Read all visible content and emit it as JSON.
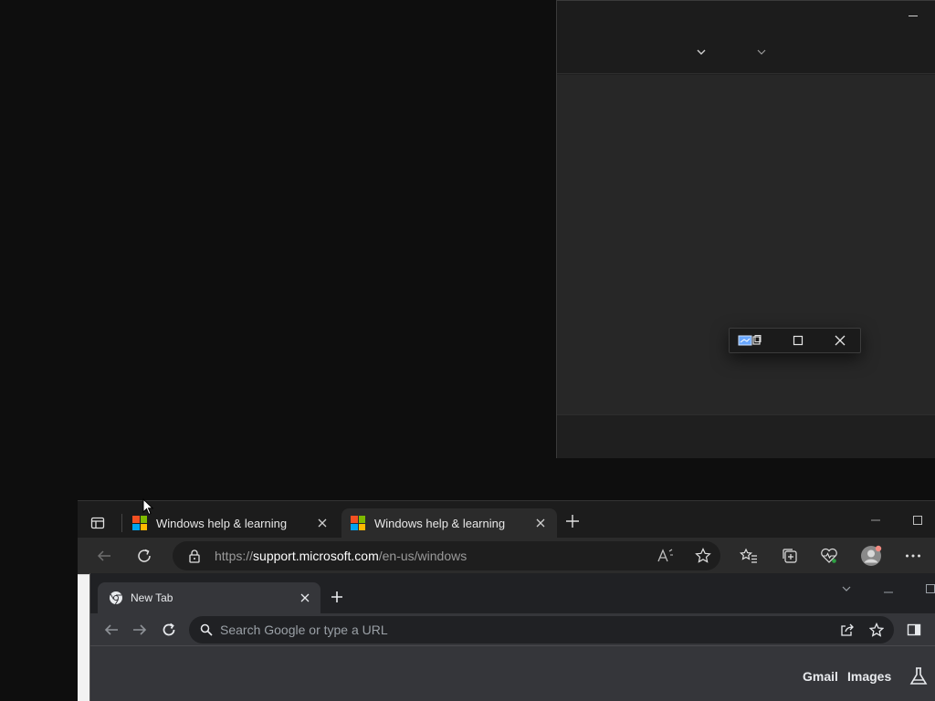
{
  "edge": {
    "tabs": [
      {
        "title": "Windows help & learning",
        "active": false
      },
      {
        "title": "Windows help & learning",
        "active": true
      }
    ],
    "address": {
      "scheme": "https://",
      "domain": "support.microsoft.com",
      "path": "/en-us/windows"
    },
    "icons": [
      "tab-actions-icon",
      "back-icon",
      "refresh-icon",
      "lock-icon",
      "read-aloud-icon",
      "favorite-star-icon",
      "favorites-icon",
      "collections-icon",
      "browser-essentials-icon",
      "profile-avatar",
      "more-icon"
    ]
  },
  "chrome": {
    "tab": {
      "title": "New Tab"
    },
    "omnibox": {
      "placeholder": "Search Google or type a URL"
    },
    "links": {
      "gmail": "Gmail",
      "images": "Images"
    },
    "icons": [
      "chrome-logo-icon",
      "back-icon",
      "forward-icon",
      "reload-icon",
      "search-icon",
      "share-icon",
      "bookmark-star-icon",
      "side-panel-icon",
      "labs-icon"
    ]
  },
  "snap_popup": {
    "icons": [
      "snap-layout-icon",
      "maximize-icon",
      "close-icon"
    ]
  },
  "colors": {
    "ms_red": "#f25022",
    "ms_green": "#7fba00",
    "ms_blue": "#00a4ef",
    "ms_yellow": "#ffb900"
  }
}
